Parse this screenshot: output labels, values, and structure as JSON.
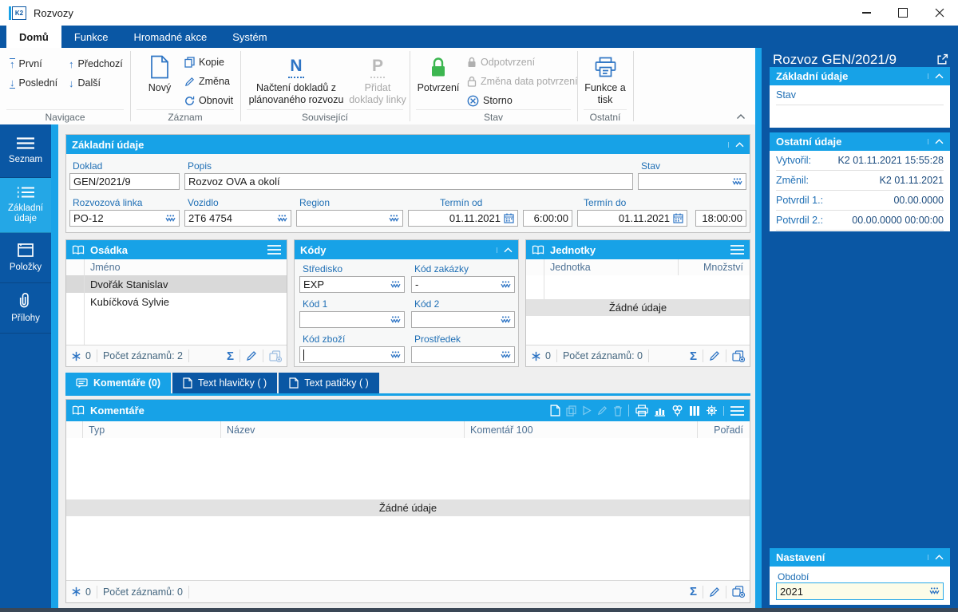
{
  "colors": {
    "dark_blue": "#0a57a4",
    "accent_cyan": "#17a2e7",
    "sidebar_active_cyan": "#24a7e6",
    "label_blue": "#1f6fb5",
    "icon_blue": "#2d74c4",
    "value_navy": "#1b4b7e",
    "confirm_green": "#3cb650",
    "selected_row_gray": "#d9d9d9",
    "period_field_bg": "#fcfce8"
  },
  "window": {
    "title": "Rozvozy",
    "icon_text": "K2"
  },
  "ribbon": {
    "tabs": [
      {
        "label": "Domů"
      },
      {
        "label": "Funkce"
      },
      {
        "label": "Hromadné akce"
      },
      {
        "label": "Systém"
      }
    ],
    "groups": {
      "navigace": {
        "label": "Navigace",
        "first": "První",
        "last": "Poslední",
        "prev": "Předchozí",
        "next": "Další"
      },
      "zaznam": {
        "label": "Záznam",
        "novy": "Nový",
        "kopie": "Kopie",
        "zmena": "Změna",
        "obnovit": "Obnovit"
      },
      "souvisejici": {
        "label": "Související",
        "nacteni_line1": "Načtení dokladů z",
        "nacteni_line2": "plánovaného rozvozu",
        "pridat_line1": "Přidat",
        "pridat_line2": "doklady linky"
      },
      "stav": {
        "label": "Stav",
        "potvrzeni": "Potvrzení",
        "odpotvrzeni": "Odpotvrzení",
        "zmena_data": "Změna data potvrzení",
        "storno": "Storno"
      },
      "ostatni": {
        "label": "Ostatní",
        "funkce_line1": "Funkce a",
        "funkce_line2": "tisk"
      }
    }
  },
  "sidebar": {
    "items": [
      {
        "label": "Seznam"
      },
      {
        "label": "Základní údaje"
      },
      {
        "label": "Položky"
      },
      {
        "label": "Přílohy"
      }
    ]
  },
  "form": {
    "title": "Základní údaje",
    "doklad": {
      "label": "Doklad",
      "value": "GEN/2021/9"
    },
    "popis": {
      "label": "Popis",
      "value": "Rozvoz OVA a okolí"
    },
    "stav": {
      "label": "Stav",
      "value": ""
    },
    "linka": {
      "label": "Rozvozová linka",
      "value": "PO-12"
    },
    "vozidlo": {
      "label": "Vozidlo",
      "value": "2T6 4754"
    },
    "region": {
      "label": "Region",
      "value": ""
    },
    "termin_od": {
      "label": "Termín od",
      "date": "01.11.2021",
      "time": "6:00:00"
    },
    "termin_do": {
      "label": "Termín do",
      "date": "01.11.2021",
      "time": "18:00:00"
    }
  },
  "osadka": {
    "title": "Osádka",
    "col_jmeno": "Jméno",
    "rows": [
      {
        "name": "Dvořák Stanislav"
      },
      {
        "name": "Kubíčková Sylvie"
      }
    ],
    "fk": "0",
    "count": "Počet záznamů: 2"
  },
  "kody": {
    "title": "Kódy",
    "stredisko": {
      "label": "Středisko",
      "value": "EXP"
    },
    "kod_zakazky": {
      "label": "Kód zakázky",
      "value": "-"
    },
    "kod1": {
      "label": "Kód 1",
      "value": ""
    },
    "kod2": {
      "label": "Kód 2",
      "value": ""
    },
    "kod_zbozi": {
      "label": "Kód zboží",
      "value": ""
    },
    "prostredek": {
      "label": "Prostředek",
      "value": ""
    }
  },
  "jednotky": {
    "title": "Jednotky",
    "col_jednotka": "Jednotka",
    "col_mnozstvi": "Množství",
    "empty": "Žádné údaje",
    "fk": "0",
    "count": "Počet záznamů: 0"
  },
  "doc_tabs": [
    {
      "label": "Komentáře (0)"
    },
    {
      "label": "Text hlavičky ( )"
    },
    {
      "label": "Text patičky ( )"
    }
  ],
  "komentare": {
    "title": "Komentáře",
    "col_typ": "Typ",
    "col_nazev": "Název",
    "col_komentar": "Komentář 100",
    "col_poradi": "Pořadí",
    "empty": "Žádné údaje",
    "fk": "0",
    "count": "Počet záznamů: 0"
  },
  "right_panel": {
    "title": "Rozvoz GEN/2021/9",
    "zakladni_title": "Základní údaje",
    "stav_label": "Stav",
    "ostatni_title": "Ostatní údaje",
    "rows": [
      {
        "label": "Vytvořil:",
        "value": "K2 01.11.2021 15:55:28"
      },
      {
        "label": "Změnil:",
        "value": "K2 01.11.2021"
      },
      {
        "label": "Potvrdil 1.:",
        "value": "00.00.0000"
      },
      {
        "label": "Potvrdil 2.:",
        "value": "00.00.0000 00:00:00"
      }
    ],
    "nastaveni_title": "Nastavení",
    "obdobi_label": "Období",
    "obdobi_value": "2021"
  }
}
